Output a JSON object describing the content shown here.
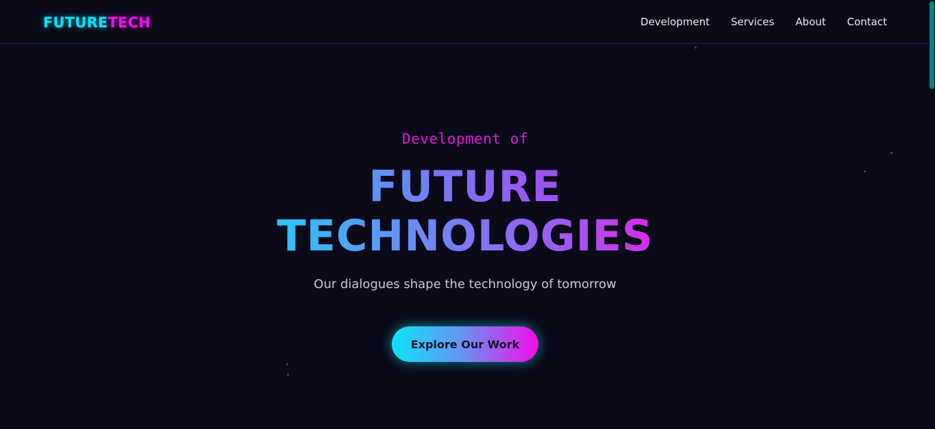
{
  "header": {
    "logo_part1": "FUTURE",
    "logo_part2": "TECH",
    "nav": [
      {
        "label": "Development"
      },
      {
        "label": "Services"
      },
      {
        "label": "About"
      },
      {
        "label": "Contact"
      }
    ]
  },
  "hero": {
    "eyebrow": "Development of",
    "headline_line1": "FUTURE",
    "headline_line2": "TECHNOLOGIES",
    "subtitle": "Our dialogues shape the technology of tomorrow",
    "cta_label": "Explore Our Work"
  },
  "colors": {
    "background": "#0a0a19",
    "accent_cyan": "#11e2f4",
    "accent_magenta": "#e815e8",
    "scrollbar_thumb": "#0c7f84"
  }
}
